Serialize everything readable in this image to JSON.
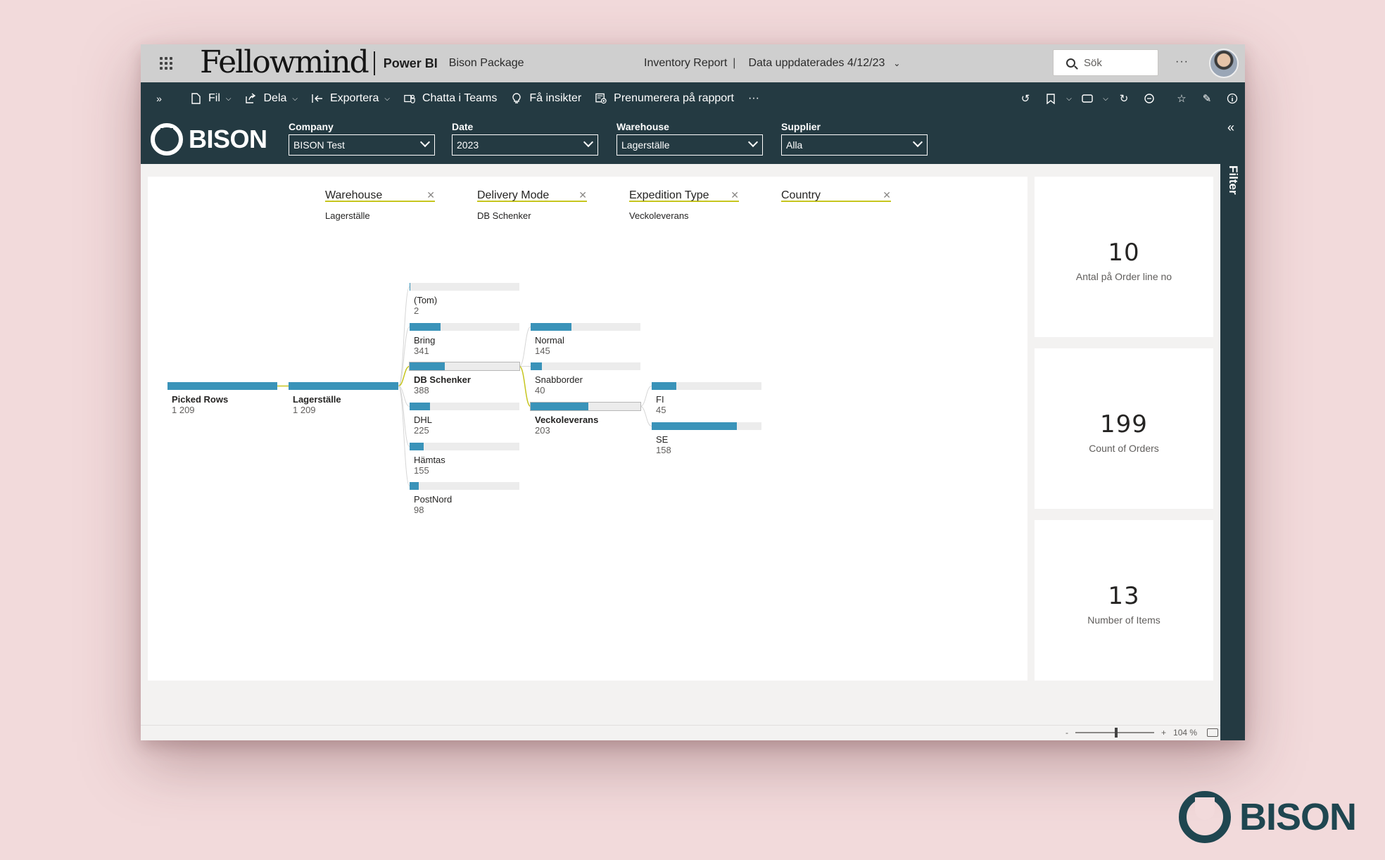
{
  "appbar": {
    "brand": "Fellowmind",
    "product": "Power BI",
    "workspace": "Bison Package",
    "report_title": "Inventory Report",
    "updated": "Data uppdaterades 4/12/23",
    "search_placeholder": "Sök",
    "more": "···"
  },
  "cmdbar": {
    "items": [
      {
        "label": "Fil",
        "icon": "file-icon"
      },
      {
        "label": "Dela",
        "icon": "share-icon"
      },
      {
        "label": "Exportera",
        "icon": "export-icon"
      },
      {
        "label": "Chatta i Teams",
        "icon": "teams-icon"
      },
      {
        "label": "Få insikter",
        "icon": "lightbulb-icon"
      },
      {
        "label": "Prenumerera på rapport",
        "icon": "subscribe-icon"
      }
    ],
    "more": "···"
  },
  "filters": {
    "logo": "BISON",
    "slicers": [
      {
        "label": "Company",
        "value": "BISON Test"
      },
      {
        "label": "Date",
        "value": "2023"
      },
      {
        "label": "Warehouse",
        "value": "Lagerställe"
      },
      {
        "label": "Supplier",
        "value": "Alla"
      }
    ]
  },
  "filter_pane": {
    "label": "Filter"
  },
  "decomposition": {
    "levels": [
      {
        "title": "Warehouse",
        "value": "Lagerställe"
      },
      {
        "title": "Delivery Mode",
        "value": "DB Schenker"
      },
      {
        "title": "Expedition Type",
        "value": "Veckoleverans"
      },
      {
        "title": "Country",
        "value": ""
      }
    ],
    "root": {
      "label": "Picked Rows",
      "value": "1 209",
      "fraction": 1.0
    },
    "warehouse": [
      {
        "label": "Lagerställe",
        "value": "1 209",
        "fraction": 1.0
      }
    ],
    "delivery_mode": [
      {
        "label": "(Tom)",
        "value": "2",
        "fraction": 0.005
      },
      {
        "label": "Bring",
        "value": "341",
        "fraction": 0.282
      },
      {
        "label": "DB Schenker",
        "value": "388",
        "fraction": 0.321,
        "selected": true
      },
      {
        "label": "DHL",
        "value": "225",
        "fraction": 0.186
      },
      {
        "label": "Hämtas",
        "value": "155",
        "fraction": 0.128
      },
      {
        "label": "PostNord",
        "value": "98",
        "fraction": 0.081
      }
    ],
    "expedition_type": [
      {
        "label": "Normal",
        "value": "145",
        "fraction": 0.374
      },
      {
        "label": "Snabborder",
        "value": "40",
        "fraction": 0.103
      },
      {
        "label": "Veckoleverans",
        "value": "203",
        "fraction": 0.523,
        "selected": true
      }
    ],
    "country": [
      {
        "label": "FI",
        "value": "45",
        "fraction": 0.222
      },
      {
        "label": "SE",
        "value": "158",
        "fraction": 0.778
      }
    ]
  },
  "cards": [
    {
      "value": "10",
      "caption": "Antal på Order line no"
    },
    {
      "value": "199",
      "caption": "Count of Orders"
    },
    {
      "value": "13",
      "caption": "Number of Items"
    }
  ],
  "statusbar": {
    "minus": "-",
    "plus": "+",
    "zoom": "104 %",
    "zoom_level": 0.52
  },
  "corner_logo": "BISON",
  "colors": {
    "bar": "#3a93b9",
    "accent_line": "#c6c51f",
    "header_dark": "#243a42"
  }
}
